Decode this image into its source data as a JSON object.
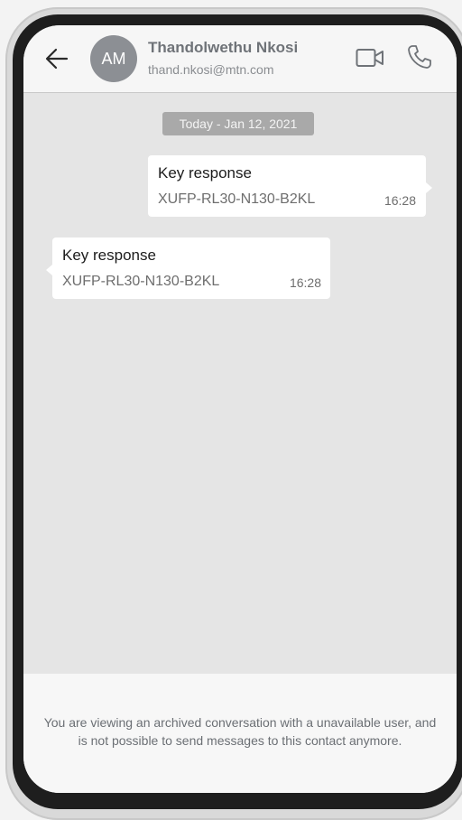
{
  "header": {
    "back_icon": "arrow-left-icon",
    "avatar_initials": "AM",
    "contact_name": "Thandolwethu Nkosi",
    "contact_email": "thand.nkosi@mtn.com",
    "video_icon": "video-camera-icon",
    "call_icon": "phone-icon"
  },
  "conversation": {
    "date_label": "Today - Jan 12, 2021",
    "messages": [
      {
        "direction": "sent",
        "title": "Key response",
        "code": "XUFP-RL30-N130-B2KL",
        "time": "16:28"
      },
      {
        "direction": "received",
        "title": "Key response",
        "code": "XUFP-RL30-N130-B2KL",
        "time": "16:28"
      }
    ]
  },
  "footer": {
    "notice": "You are viewing an archived conversation with a unavailable user, and is not possible to send messages to this contact anymore."
  },
  "colors": {
    "chat_background": "#e5e5e5",
    "bubble": "#ffffff",
    "date_pill": "#a9a9a9",
    "avatar": "#8c8f94"
  }
}
